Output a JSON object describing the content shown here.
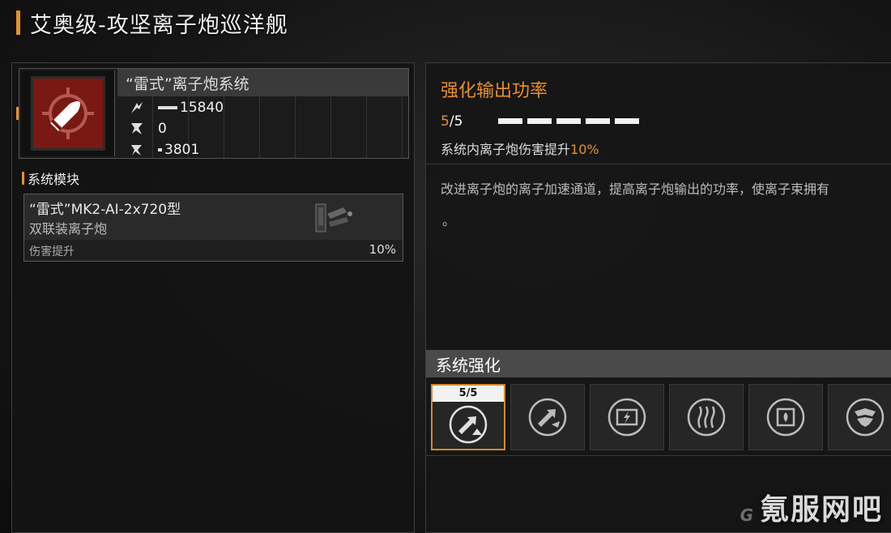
{
  "title": "艾奥级-攻坚离子炮巡洋舰",
  "weapon": {
    "name": "“雷式”离子炮系统",
    "icon": "ion-bullet-crosshair-icon",
    "stats": [
      {
        "icon": "damage-icon",
        "value": "15840"
      },
      {
        "icon": "penetration-icon",
        "value": "0"
      },
      {
        "icon": "range-icon",
        "value": "3801"
      }
    ]
  },
  "modules": {
    "label": "系统模块",
    "items": [
      {
        "name": "“雷式”MK2-AI-2x720型",
        "subtitle": "双联装离子炮",
        "stat_label": "伤害提升",
        "stat_value": "10%"
      }
    ]
  },
  "enhancement": {
    "title": "强化输出功率",
    "level_current": "5",
    "level_sep": "/",
    "level_max": "5",
    "pips_filled": 5,
    "pips_total": 5,
    "effect_text": "系统内离子炮伤害提升",
    "effect_value": "10%",
    "description": "改进离子炮的离子加速通道，提高离子炮输出的功率，使离子束拥有",
    "description_tail": "。"
  },
  "system_enhance": {
    "label": "系统强化",
    "slots": [
      {
        "icon": "power-up-arrow-icon",
        "level": "5/5",
        "active": true
      },
      {
        "icon": "power-arrow-icon",
        "active": false
      },
      {
        "icon": "energy-card-icon",
        "active": false
      },
      {
        "icon": "heat-waves-icon",
        "active": false
      },
      {
        "icon": "chip-shield-icon",
        "active": false
      },
      {
        "icon": "beast-emblem-icon",
        "active": false
      }
    ]
  },
  "watermark": "氪服网吧",
  "watermark_small": "G"
}
